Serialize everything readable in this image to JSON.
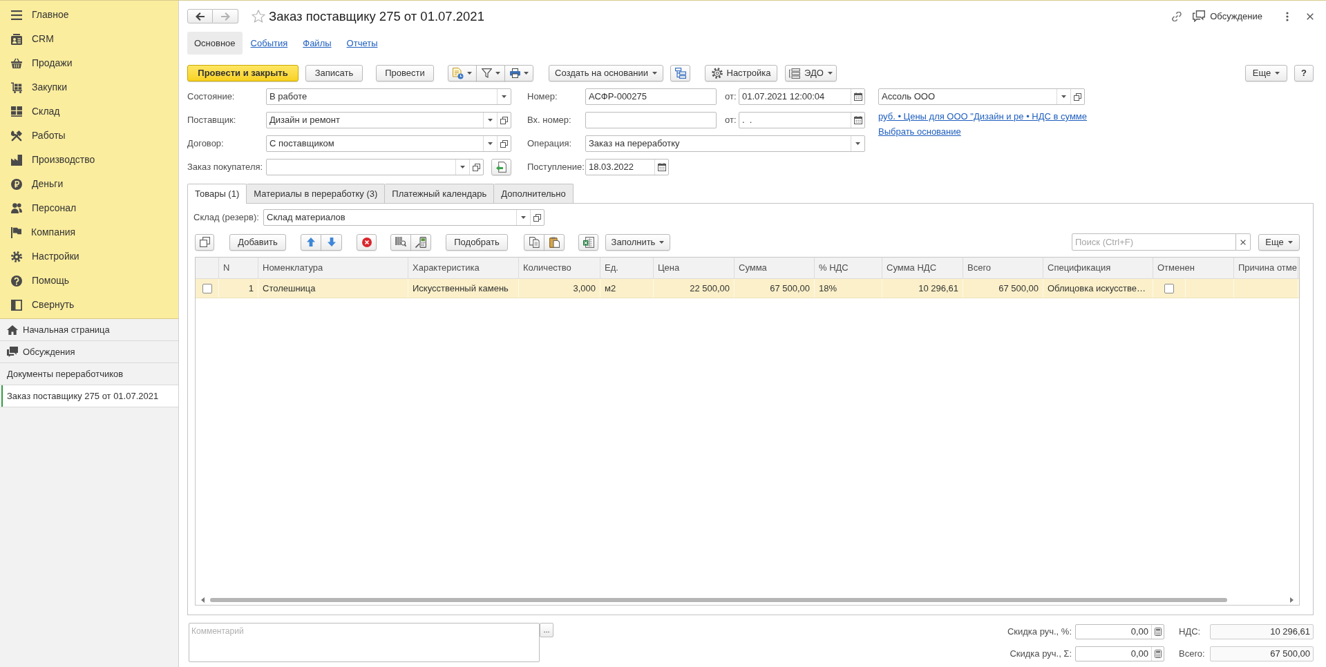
{
  "sidebar": {
    "sections": [
      {
        "label": "Главное"
      },
      {
        "label": "CRM"
      },
      {
        "label": "Продажи"
      },
      {
        "label": "Закупки"
      },
      {
        "label": "Склад"
      },
      {
        "label": "Работы"
      },
      {
        "label": "Производство"
      },
      {
        "label": "Деньги"
      },
      {
        "label": "Персонал"
      },
      {
        "label": "Компания"
      },
      {
        "label": "Настройки"
      },
      {
        "label": "Помощь"
      },
      {
        "label": "Свернуть"
      }
    ],
    "open_items": [
      {
        "label": "Начальная страница",
        "selected": false
      },
      {
        "label": "Обсуждения",
        "selected": false
      },
      {
        "label": "Документы переработчиков",
        "selected": false
      },
      {
        "label": "Заказ поставщику 275 от 01.07.2021",
        "selected": true
      }
    ]
  },
  "header": {
    "nav": [
      {
        "kind": "back",
        "disabled": false
      },
      {
        "kind": "forward",
        "disabled": true
      }
    ],
    "favorite": false,
    "title": "Заказ поставщику 275 от 01.07.2021",
    "discussion": "Обсуждение"
  },
  "section_tabs": [
    {
      "label": "Основное",
      "selected": true
    },
    {
      "label": "События",
      "selected": false
    },
    {
      "label": "Файлы",
      "selected": false
    },
    {
      "label": "Отчеты",
      "selected": false
    }
  ],
  "toolbar": {
    "post_and_close": "Провести и закрыть",
    "save": "Записать",
    "post": "Провести",
    "create_based_on": "Создать на основании",
    "settings": "Настройка",
    "edo": "ЭДО",
    "more": "Еще",
    "help": "?"
  },
  "form": {
    "left": [
      {
        "label": "Состояние:",
        "value": "В работе",
        "kind": "select"
      },
      {
        "label": "Поставщик:",
        "value": "Дизайн и ремонт",
        "kind": "reference"
      },
      {
        "label": "Договор:",
        "value": "С поставщиком",
        "kind": "reference"
      },
      {
        "label": "Заказ покупателя:",
        "kind": "reference_action"
      }
    ],
    "number": {
      "label": "Номер:",
      "value": "АСФР-000275",
      "date_label": "от:",
      "date": "01.07.2021 12:00:04"
    },
    "incoming": {
      "label": "Вх. номер:",
      "date_label": "от:",
      "date": ".  ."
    },
    "operation": {
      "label": "Операция:",
      "value": "Заказ на переработку"
    },
    "receipt": {
      "label": "Поступление:",
      "value": "18.03.2022"
    },
    "organization": {
      "value": "Ассоль ООО"
    },
    "links": [
      {
        "text": "руб. • Цены для ООО \"Дизайн и ре • НДС в сумме"
      },
      {
        "text": "Выбрать основание"
      }
    ]
  },
  "document_tabs": [
    {
      "label": "Товары (1)",
      "selected": true
    },
    {
      "label": "Материалы в переработку (3)",
      "selected": false
    },
    {
      "label": "Платежный календарь",
      "selected": false
    },
    {
      "label": "Дополнительно",
      "selected": false
    }
  ],
  "goods": {
    "warehouse": {
      "label": "Склад (резерв):",
      "value": "Склад материалов"
    },
    "toolbar": {
      "add": "Добавить",
      "pick": "Подобрать",
      "fill": "Заполнить",
      "more": "Еще"
    },
    "search": {
      "placeholder": "Поиск (Ctrl+F)"
    },
    "table": {
      "columns": [
        {
          "kind": "check"
        },
        {
          "label": "N",
          "kind": "number"
        },
        {
          "label": "Номенклатура",
          "kind": "text"
        },
        {
          "label": "Характеристика",
          "kind": "text"
        },
        {
          "label": "Количество",
          "kind": "number"
        },
        {
          "label": "Ед.",
          "kind": "text"
        },
        {
          "label": "Цена",
          "kind": "number"
        },
        {
          "label": "Сумма",
          "kind": "number"
        },
        {
          "label": "% НДС",
          "kind": "text"
        },
        {
          "label": "Сумма НДС",
          "kind": "number"
        },
        {
          "label": "Всего",
          "kind": "number"
        },
        {
          "label": "Спецификация",
          "kind": "text"
        },
        {
          "label": "Отменен",
          "kind": "check"
        },
        {
          "label": "Причина отме"
        }
      ],
      "rows": [
        {
          "selected": true,
          "cells": [
            {
              "checked": false
            },
            {
              "text": "1"
            },
            {
              "text": "Столешница"
            },
            {
              "text": "Искусственный камень"
            },
            {
              "text": "3,000"
            },
            {
              "text": "м2"
            },
            {
              "text": "22 500,00"
            },
            {
              "text": "67 500,00"
            },
            {
              "text": "18%"
            },
            {
              "text": "10 296,61"
            },
            {
              "text": "67 500,00"
            },
            {
              "text": "Облицовка искусстве…"
            },
            {
              "checked": false
            }
          ]
        }
      ]
    }
  },
  "footer": {
    "comment": {
      "placeholder": "Комментарий",
      "button": "..."
    },
    "discounts": [
      {
        "label": "Скидка руч., %:",
        "value": "0,00"
      },
      {
        "label": "Скидка руч., Σ:",
        "value": "0,00"
      }
    ],
    "totals": [
      {
        "label": "НДС:",
        "value": "10 296,61"
      },
      {
        "label": "Всего:",
        "value": "67 500,00"
      }
    ]
  }
}
